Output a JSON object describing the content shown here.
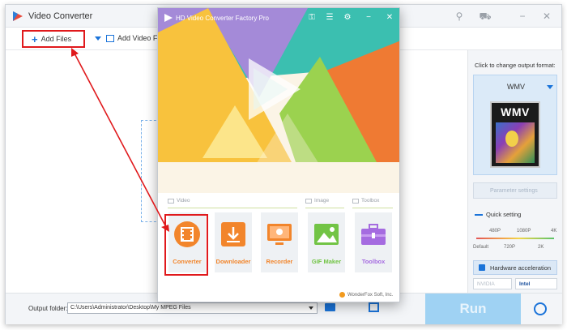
{
  "window": {
    "title": "Video Converter"
  },
  "toolbar": {
    "add_files": "Add Files",
    "add_folder": "Add Video Fold"
  },
  "right_panel": {
    "heading": "Click to change output format:",
    "format": "WMV",
    "thumb_text": "WMV",
    "param_settings": "Parameter settings",
    "quick_setting": "Quick setting",
    "quality_top": [
      "480P",
      "1080P",
      "4K"
    ],
    "quality_bottom": [
      "Default",
      "720P",
      "2K"
    ],
    "hw_accel": "Hardware acceleration",
    "gpu_chips": [
      "NVIDIA",
      "Intel"
    ]
  },
  "bottom": {
    "output_label": "Output folder:",
    "output_path": "C:\\Users\\Administrator\\Desktop\\My MPEG Files",
    "run": "Run"
  },
  "overlay": {
    "title": "HD Video Converter Factory Pro",
    "sections": [
      "Video",
      "Image",
      "Toolbox"
    ],
    "tools": [
      "Converter",
      "Downloader",
      "Recorder",
      "GIF Maker",
      "Toolbox"
    ],
    "footer": "WonderFox Soft, Inc."
  },
  "colors": {
    "accent_blue": "#1a73d9",
    "highlight_red": "#e0191c",
    "tool_orange": "#f2852b",
    "tool_green": "#72c445",
    "tool_purple": "#a56be0",
    "run_button": "#9fd2f3"
  },
  "icons": {
    "titlebar": [
      "pin-icon",
      "cart-icon",
      "minimize-icon",
      "close-icon"
    ],
    "overlay_titlebar": [
      "key-icon",
      "list-icon",
      "settings-icon",
      "minimize-icon",
      "close-icon"
    ]
  }
}
